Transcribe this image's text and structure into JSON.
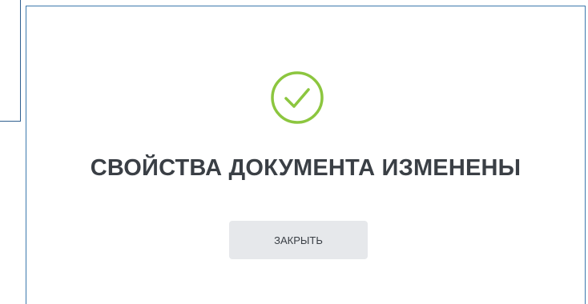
{
  "dialog": {
    "title": "СВОЙСТВА ДОКУМЕНТА ИЗМЕНЕНЫ",
    "close_label": "ЗАКРЫТЬ",
    "status_icon": "check-circle-icon"
  },
  "colors": {
    "success": "#8cc63f",
    "title_text": "#3a3f45",
    "button_bg": "#e6e8eb",
    "modal_border": "#3c78ad"
  }
}
